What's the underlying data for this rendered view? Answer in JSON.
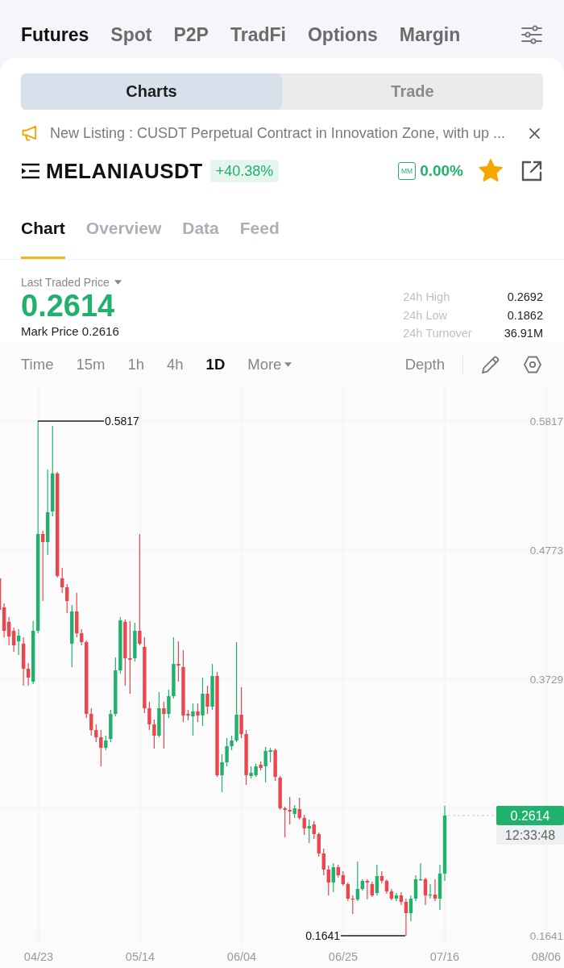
{
  "top_nav": [
    {
      "label": "Futures",
      "selected": true
    },
    {
      "label": "Spot",
      "selected": false
    },
    {
      "label": "P2P",
      "selected": false
    },
    {
      "label": "TradFi",
      "selected": false
    },
    {
      "label": "Options",
      "selected": false
    },
    {
      "label": "Margin",
      "selected": false
    }
  ],
  "view_toggle": [
    {
      "label": "Charts",
      "selected": true
    },
    {
      "label": "Trade",
      "selected": false
    }
  ],
  "announcement": {
    "text": "New Listing : CUSDT Perpetual Contract in Innovation Zone, with up ..."
  },
  "symbol": {
    "name": "MELANIAUSDT",
    "change": "+40.38%",
    "mm_label": "MM",
    "funding_rate": "0.00%",
    "favorite": true
  },
  "tabs": [
    {
      "label": "Chart",
      "selected": true
    },
    {
      "label": "Overview",
      "selected": false
    },
    {
      "label": "Data",
      "selected": false
    },
    {
      "label": "Feed",
      "selected": false
    }
  ],
  "price": {
    "label": "Last Traded Price",
    "rising": true,
    "last": "0.2614",
    "mark": "Mark Price 0.2616"
  },
  "stats": [
    {
      "label": "24h High",
      "value": "0.2692"
    },
    {
      "label": "24h Low",
      "value": "0.1862"
    },
    {
      "label": "24h Turnover",
      "value": "36.91M"
    }
  ],
  "intervals": [
    {
      "label": "Time",
      "kind": "interval",
      "selected": false
    },
    {
      "label": "15m",
      "kind": "interval",
      "selected": false
    },
    {
      "label": "1h",
      "kind": "interval",
      "selected": false
    },
    {
      "label": "4h",
      "kind": "interval",
      "selected": false
    },
    {
      "label": "1D",
      "kind": "interval",
      "selected": true
    },
    {
      "label": "More",
      "kind": "dropdown",
      "selected": false
    }
  ],
  "depth": "Depth",
  "chart": {
    "y_axis": [
      "0.5817",
      "0.4773",
      "0.3729",
      "0.1641"
    ],
    "x_axis": [
      "04/23",
      "05/14",
      "06/04",
      "06/25",
      "07/16",
      "08/06"
    ],
    "high_label": "0.5817",
    "low_label": "0.1641",
    "last_price": "0.2614",
    "countdown": "12:33:48"
  }
}
